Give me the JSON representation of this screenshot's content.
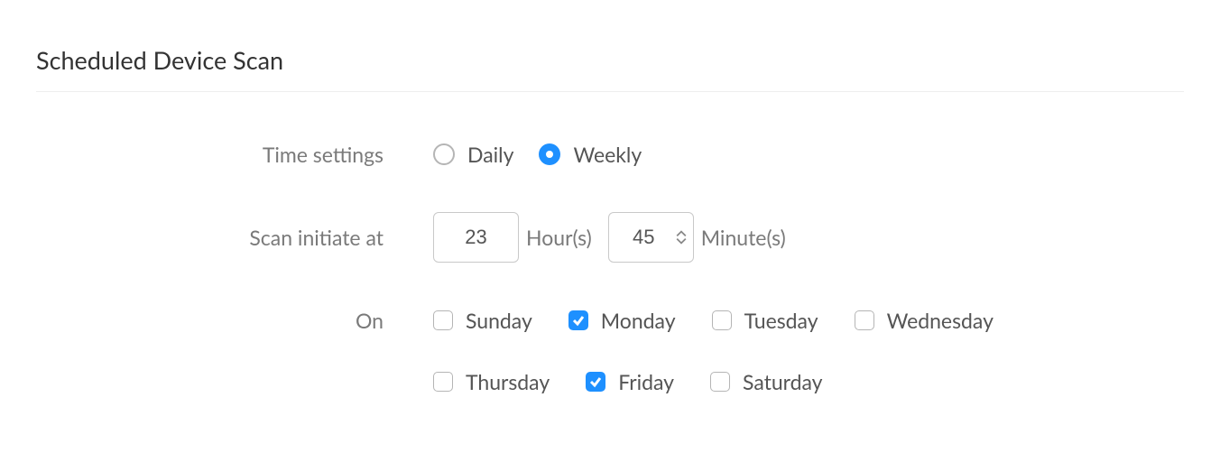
{
  "section": {
    "title": "Scheduled Device Scan"
  },
  "form": {
    "timeSettings": {
      "label": "Time settings",
      "options": {
        "daily": "Daily",
        "weekly": "Weekly"
      },
      "selected": "weekly"
    },
    "scanInitiate": {
      "label": "Scan initiate at",
      "hour": "23",
      "hourUnit": "Hour(s)",
      "minute": "45",
      "minuteUnit": "Minute(s)"
    },
    "on": {
      "label": "On",
      "days": {
        "sunday": {
          "label": "Sunday",
          "checked": false
        },
        "monday": {
          "label": "Monday",
          "checked": true
        },
        "tuesday": {
          "label": "Tuesday",
          "checked": false
        },
        "wednesday": {
          "label": "Wednesday",
          "checked": false
        },
        "thursday": {
          "label": "Thursday",
          "checked": false
        },
        "friday": {
          "label": "Friday",
          "checked": true
        },
        "saturday": {
          "label": "Saturday",
          "checked": false
        }
      }
    }
  }
}
